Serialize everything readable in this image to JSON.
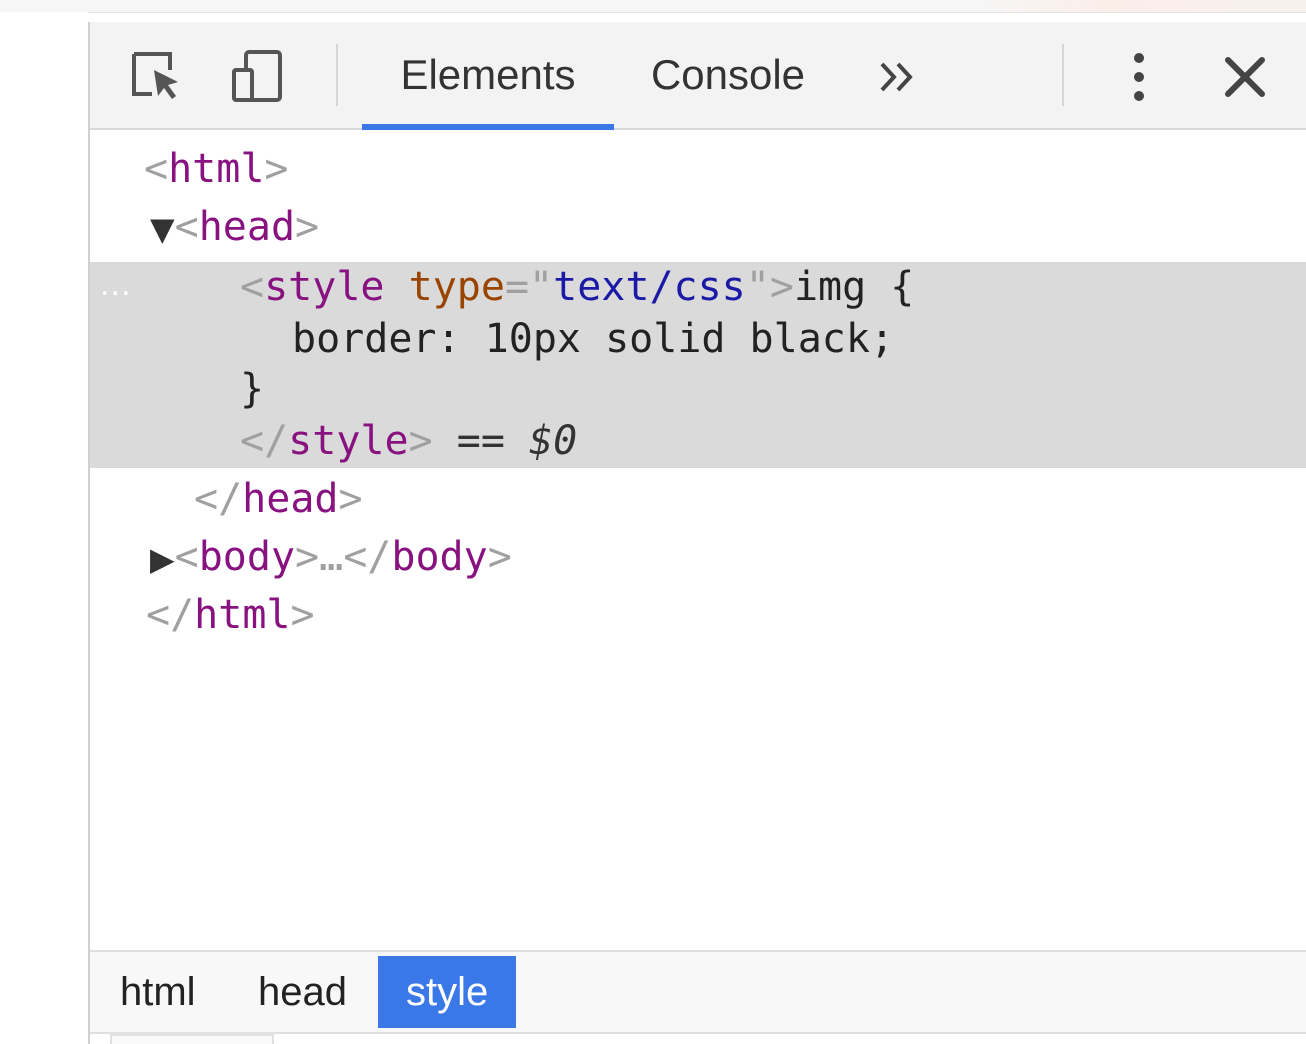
{
  "toolbar": {
    "icons": [
      "inspect-element-icon",
      "device-toolbar-icon"
    ],
    "tabs": [
      {
        "label": "Elements",
        "active": true
      },
      {
        "label": "Console",
        "active": false
      }
    ],
    "more_tabs_symbol": "»",
    "kebab_icon": "more-options-icon",
    "close_icon": "close-icon",
    "accent_color": "#3b78e7"
  },
  "tree": {
    "html_open": {
      "open": "<",
      "tag": "html",
      "close": ">"
    },
    "head_open": {
      "arrow": "▼",
      "open": "<",
      "tag": "head",
      "close": ">"
    },
    "style_open": {
      "open": "<",
      "tag": "style",
      "attr": "type",
      "eq": "=\"",
      "value": "text/css",
      "quote_close": "\">",
      "text": "img {"
    },
    "style_body": "border: 10px solid black;",
    "style_brace": "}",
    "style_close": {
      "open": "</",
      "tag": "style",
      "close": ">",
      "hint": " == ",
      "dollar": "$0"
    },
    "head_close": {
      "open": "</",
      "tag": "head",
      "close": ">"
    },
    "body_row": {
      "arrow": "▶",
      "open": "<",
      "tag": "body",
      "mid": ">…</",
      "tag2": "body",
      "close": ">"
    },
    "html_close": {
      "open": "</",
      "tag": "html",
      "close": ">"
    },
    "gutter_dots": "..."
  },
  "breadcrumbs": [
    {
      "label": "html",
      "active": false
    },
    {
      "label": "head",
      "active": false
    },
    {
      "label": "style",
      "active": true
    }
  ]
}
